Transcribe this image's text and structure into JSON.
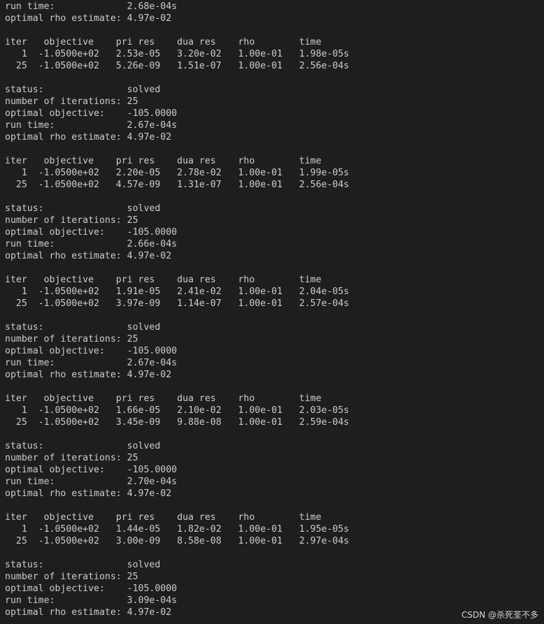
{
  "terminal": {
    "lines": [
      "run time:             2.68e-04s",
      "optimal rho estimate: 4.97e-02",
      "",
      "iter   objective    pri res    dua res    rho        time",
      "   1  -1.0500e+02   2.53e-05   3.20e-02   1.00e-01   1.98e-05s",
      "  25  -1.0500e+02   5.26e-09   1.51e-07   1.00e-01   2.56e-04s",
      "",
      "status:               solved",
      "number of iterations: 25",
      "optimal objective:    -105.0000",
      "run time:             2.67e-04s",
      "optimal rho estimate: 4.97e-02",
      "",
      "iter   objective    pri res    dua res    rho        time",
      "   1  -1.0500e+02   2.20e-05   2.78e-02   1.00e-01   1.99e-05s",
      "  25  -1.0500e+02   4.57e-09   1.31e-07   1.00e-01   2.56e-04s",
      "",
      "status:               solved",
      "number of iterations: 25",
      "optimal objective:    -105.0000",
      "run time:             2.66e-04s",
      "optimal rho estimate: 4.97e-02",
      "",
      "iter   objective    pri res    dua res    rho        time",
      "   1  -1.0500e+02   1.91e-05   2.41e-02   1.00e-01   2.04e-05s",
      "  25  -1.0500e+02   3.97e-09   1.14e-07   1.00e-01   2.57e-04s",
      "",
      "status:               solved",
      "number of iterations: 25",
      "optimal objective:    -105.0000",
      "run time:             2.67e-04s",
      "optimal rho estimate: 4.97e-02",
      "",
      "iter   objective    pri res    dua res    rho        time",
      "   1  -1.0500e+02   1.66e-05   2.10e-02   1.00e-01   2.03e-05s",
      "  25  -1.0500e+02   3.45e-09   9.88e-08   1.00e-01   2.59e-04s",
      "",
      "status:               solved",
      "number of iterations: 25",
      "optimal objective:    -105.0000",
      "run time:             2.70e-04s",
      "optimal rho estimate: 4.97e-02",
      "",
      "iter   objective    pri res    dua res    rho        time",
      "   1  -1.0500e+02   1.44e-05   1.82e-02   1.00e-01   1.95e-05s",
      "  25  -1.0500e+02   3.00e-09   8.58e-08   1.00e-01   2.97e-04s",
      "",
      "status:               solved",
      "number of iterations: 25",
      "optimal objective:    -105.0000",
      "run time:             3.09e-04s",
      "optimal rho estimate: 4.97e-02"
    ]
  },
  "watermark": {
    "text": "CSDN @杀死荃不多"
  },
  "colors": {
    "background": "#1e1e1e",
    "text": "#cccccc"
  }
}
